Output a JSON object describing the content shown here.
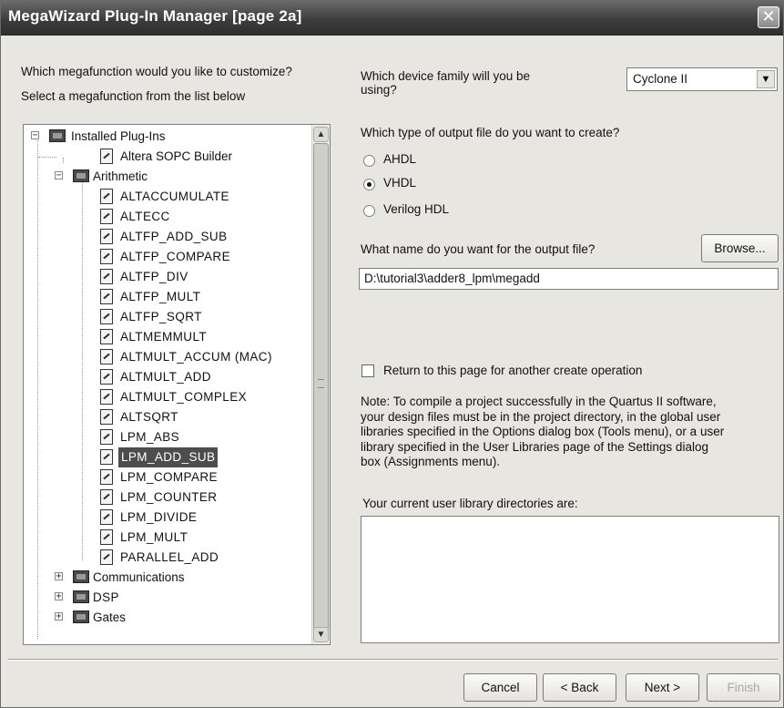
{
  "window": {
    "title": "MegaWizard Plug-In Manager [page 2a]",
    "close_icon": "close-icon"
  },
  "left": {
    "question": "Which megafunction would you like to customize?",
    "instruction": "Select a megafunction from the list below"
  },
  "tree": {
    "root": "Installed Plug-Ins",
    "sopc": "Altera SOPC Builder",
    "arithmetic": "Arithmetic",
    "items": [
      "ALTACCUMULATE",
      "ALTECC",
      "ALTFP_ADD_SUB",
      "ALTFP_COMPARE",
      "ALTFP_DIV",
      "ALTFP_MULT",
      "ALTFP_SQRT",
      "ALTMEMMULT",
      "ALTMULT_ACCUM (MAC)",
      "ALTMULT_ADD",
      "ALTMULT_COMPLEX",
      "ALTSQRT",
      "LPM_ABS",
      "LPM_ADD_SUB",
      "LPM_COMPARE",
      "LPM_COUNTER",
      "LPM_DIVIDE",
      "LPM_MULT",
      "PARALLEL_ADD"
    ],
    "selected": "LPM_ADD_SUB",
    "folders": [
      "Communications",
      "DSP",
      "Gates"
    ]
  },
  "device": {
    "question_line1": "Which device family will you be",
    "question_line2": "using?",
    "value": "Cyclone II"
  },
  "output_type": {
    "question": "Which type of output file do you want to create?",
    "options": [
      "AHDL",
      "VHDL",
      "Verilog HDL"
    ],
    "selected": "VHDL"
  },
  "output_file": {
    "question": "What name do you want for the output file?",
    "browse": "Browse...",
    "value": "D:\\tutorial3\\adder8_lpm\\megadd"
  },
  "return_checkbox": {
    "label": "Return to this page for another create operation",
    "checked": false
  },
  "note": {
    "line1": "Note: To compile a project successfully in the Quartus II software,",
    "line2": "your design files must be in the project directory, in the global user",
    "line3": "libraries specified in the Options dialog box (Tools menu), or a user",
    "line4": "library specified in the User Libraries page of the Settings dialog",
    "line5": "box (Assignments menu)."
  },
  "libraries": {
    "label": "Your current user library directories are:"
  },
  "buttons": {
    "cancel": "Cancel",
    "back": "< Back",
    "next": "Next >",
    "finish": "Finish"
  }
}
